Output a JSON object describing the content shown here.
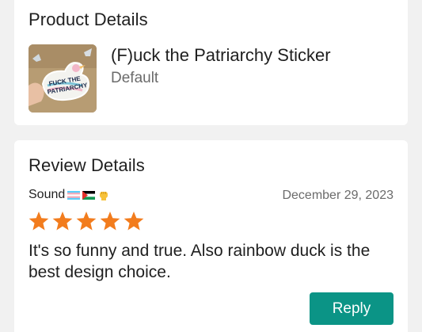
{
  "product_section": {
    "title": "Product Details",
    "product_name": "(F)uck the Patriarchy Sticker",
    "variant": "Default",
    "thumbnail_icon": "duck-sticker-image",
    "thumbnail_text": "FUCK THE PATRIARCHY"
  },
  "review_section": {
    "title": "Review Details",
    "reviewer_name": "Sound",
    "reviewer_emojis": [
      "transgender-flag",
      "palestine-flag",
      "raised-fist"
    ],
    "date": "December 29, 2023",
    "rating": 5,
    "rating_max": 5,
    "review_text": "It's so funny and true. Also rainbow duck is the best design choice.",
    "reply_label": "Reply"
  },
  "colors": {
    "background": "#f1f1f1",
    "card": "#ffffff",
    "star": "#f27c1d",
    "reply_button": "#0b9486",
    "muted_text": "#6b6b6b"
  }
}
